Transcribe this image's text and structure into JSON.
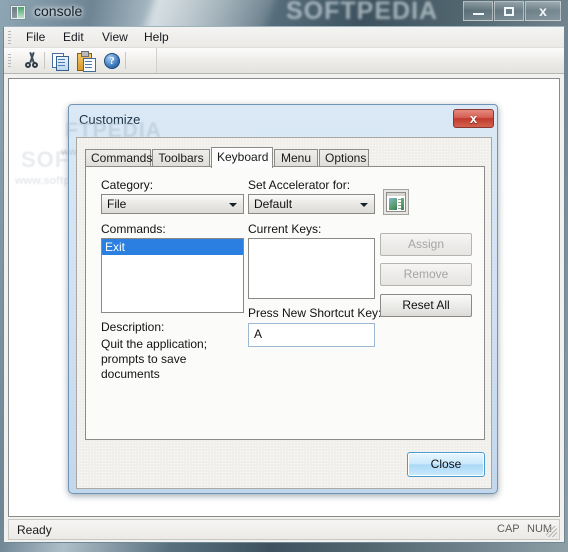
{
  "desktop": {
    "watermark_top": "SOFTPEDIA",
    "watermark_client": "SOFTPEDIA",
    "watermark_client_sub": "www.softpedia.com",
    "dialog_watermark": "FTPEDIA",
    "dialog_watermark_sub": "www.softp"
  },
  "app_window": {
    "title": "console",
    "icon": "console-window-icon",
    "controls": {
      "minimize": "minimize-icon",
      "maximize": "maximize-icon",
      "close": "x"
    }
  },
  "menubar": {
    "items": [
      {
        "label": "File"
      },
      {
        "label": "Edit"
      },
      {
        "label": "View"
      },
      {
        "label": "Help"
      }
    ]
  },
  "toolbar": {
    "buttons": [
      {
        "name": "cut-icon",
        "tooltip": "Cut"
      },
      {
        "name": "copy-icon",
        "tooltip": "Copy"
      },
      {
        "name": "paste-icon",
        "tooltip": "Paste"
      },
      {
        "name": "help-icon",
        "tooltip": "Help",
        "glyph": "?"
      }
    ]
  },
  "statusbar": {
    "message": "Ready",
    "caps_lock": "CAP",
    "num_lock": "NUM"
  },
  "dialog": {
    "title": "Customize",
    "close_glyph": "x",
    "tabs": [
      {
        "label": "Commands",
        "active": false
      },
      {
        "label": "Toolbars",
        "active": false
      },
      {
        "label": "Keyboard",
        "active": true
      },
      {
        "label": "Menu",
        "active": false
      },
      {
        "label": "Options",
        "active": false
      }
    ],
    "keyboard_page": {
      "category_label": "Category:",
      "category_value": "File",
      "accelerator_label": "Set Accelerator for:",
      "accelerator_value": "Default",
      "accelerator_icon": "window-preview-icon",
      "commands_label": "Commands:",
      "commands_items": [
        {
          "label": "Exit",
          "selected": true
        }
      ],
      "current_keys_label": "Current Keys:",
      "current_keys_items": [],
      "shortcut_label": "Press New Shortcut Key:",
      "shortcut_value": "A",
      "description_label": "Description:",
      "description_text": "Quit the application; prompts to save documents",
      "assign_label": "Assign",
      "assign_enabled": false,
      "remove_label": "Remove",
      "remove_enabled": false,
      "reset_all_label": "Reset All",
      "reset_all_enabled": true
    },
    "close_button_label": "Close"
  }
}
